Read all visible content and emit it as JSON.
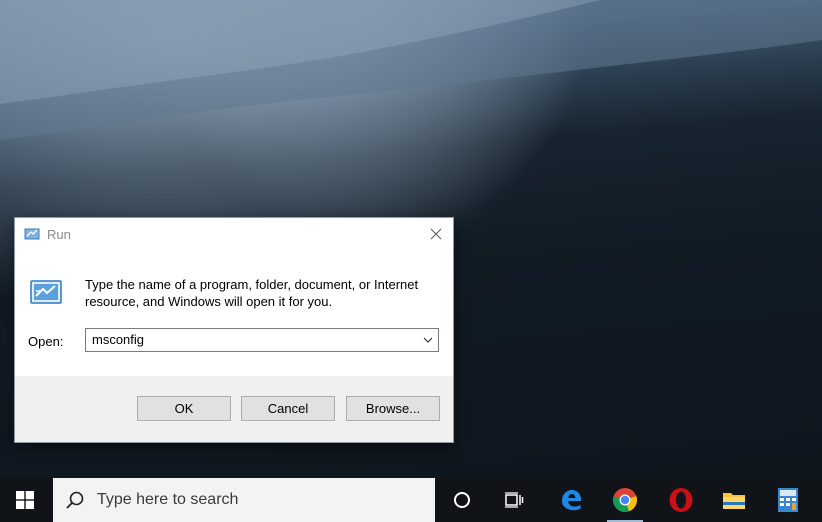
{
  "dialog": {
    "title": "Run",
    "description": "Type the name of a program, folder, document, or Internet resource, and Windows will open it for you.",
    "open_label": "Open:",
    "open_value": "msconfig",
    "buttons": {
      "ok": "OK",
      "cancel": "Cancel",
      "browse": "Browse..."
    }
  },
  "taskbar": {
    "search_placeholder": "Type here to search",
    "icons": [
      "windows-start-icon",
      "search-icon",
      "cortana-icon",
      "task-view-icon",
      "edge-icon",
      "chrome-icon",
      "opera-icon",
      "file-explorer-icon",
      "calculator-icon"
    ]
  },
  "colors": {
    "accent": "#0078d7",
    "taskbar": "#101418",
    "button_face": "#e1e1e1"
  }
}
